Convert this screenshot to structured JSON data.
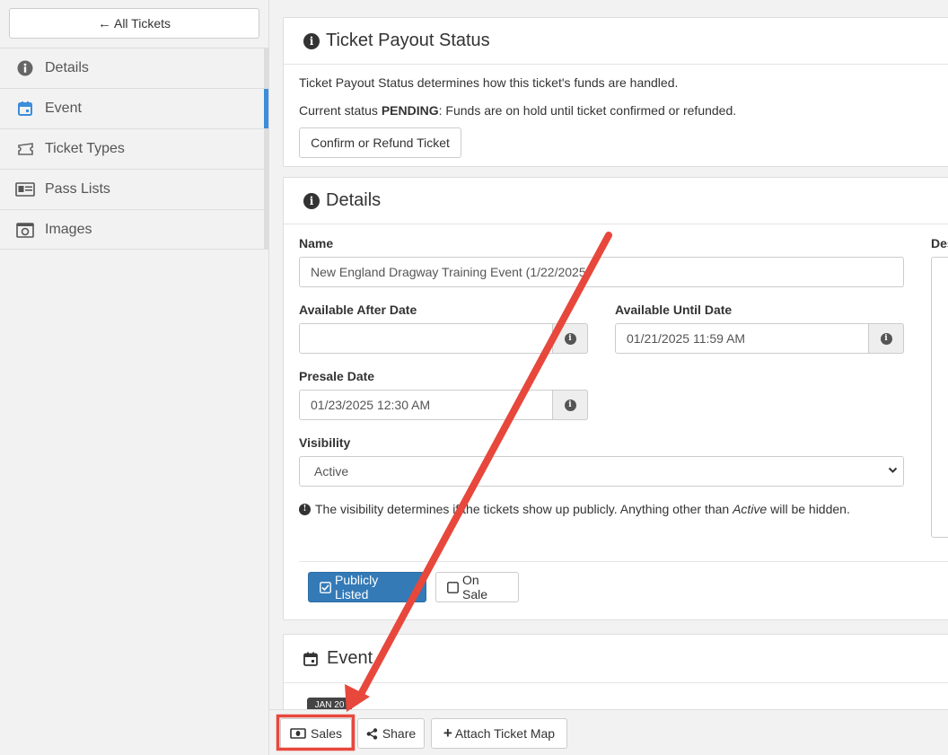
{
  "sidebar": {
    "back_label": "All Tickets",
    "items": [
      {
        "label": "Details",
        "icon": "info-circle-icon",
        "active": false
      },
      {
        "label": "Event",
        "icon": "calendar-icon",
        "active": true
      },
      {
        "label": "Ticket Types",
        "icon": "ticket-icon",
        "active": false
      },
      {
        "label": "Pass Lists",
        "icon": "id-card-icon",
        "active": false
      },
      {
        "label": "Images",
        "icon": "camera-icon",
        "active": false
      }
    ]
  },
  "payout": {
    "title": "Ticket Payout Status",
    "description": "Ticket Payout Status determines how this ticket's funds are handled.",
    "status_prefix": "Current status",
    "status_value": "PENDING",
    "status_suffix": ": Funds are on hold until ticket confirmed or refunded.",
    "action_label": "Confirm or Refund Ticket"
  },
  "details": {
    "title": "Details",
    "name_label": "Name",
    "name_value": "New England Dragway Training Event (1/22/2025",
    "available_after_label": "Available After Date",
    "available_after_value": "",
    "available_until_label": "Available Until Date",
    "available_until_value": "01/21/2025 11:59 AM",
    "presale_label": "Presale Date",
    "presale_value": "01/23/2025 12:30 AM",
    "visibility_label": "Visibility",
    "visibility_value": "Active",
    "visibility_note_a": "The visibility determines if the tickets show up publicly. Anything other than",
    "visibility_note_em": "Active",
    "visibility_note_b": "will be hidden.",
    "description_label": "Des",
    "publicly_listed_label": "Publicly Listed",
    "on_sale_label": "On Sale"
  },
  "event_section": {
    "title": "Event",
    "date_badge": "JAN 20"
  },
  "toolbar": {
    "sales_label": "Sales",
    "share_label": "Share",
    "attach_map_label": "Attach Ticket Map"
  },
  "colors": {
    "accent": "#3c8dda",
    "primary_button": "#337ab7",
    "annotation": "#e8473c"
  }
}
